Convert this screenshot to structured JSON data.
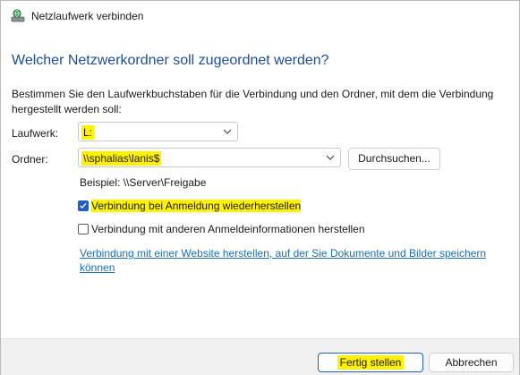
{
  "window": {
    "title": "Netzlaufwerk verbinden"
  },
  "heading": "Welcher Netzwerkordner soll zugeordnet werden?",
  "description": "Bestimmen Sie den Laufwerkbuchstaben für die Verbindung und den Ordner, mit dem die Verbindung hergestellt werden soll:",
  "drive": {
    "label": "Laufwerk:",
    "value": "L:"
  },
  "folder": {
    "label": "Ordner:",
    "value": "\\\\sphalias\\lanis$"
  },
  "browse_button": "Durchsuchen...",
  "example": "Beispiel: \\\\Server\\Freigabe",
  "checkboxes": [
    {
      "label": "Verbindung bei Anmeldung wiederherstellen",
      "checked": true,
      "highlighted": true
    },
    {
      "label": "Verbindung mit anderen Anmeldeinformationen herstellen",
      "checked": false,
      "highlighted": false
    }
  ],
  "link": "Verbindung mit einer Website herstellen, auf der Sie Dokumente und Bilder speichern können",
  "footer": {
    "finish_button": "Fertig stellen",
    "cancel_button": "Abbrechen"
  },
  "colors": {
    "heading": "#1a4d9c",
    "link": "#1a6fb5",
    "highlight": "#fff200",
    "checkbox": "#1f5fbf"
  },
  "icons": {
    "title": "network-drive-icon"
  }
}
